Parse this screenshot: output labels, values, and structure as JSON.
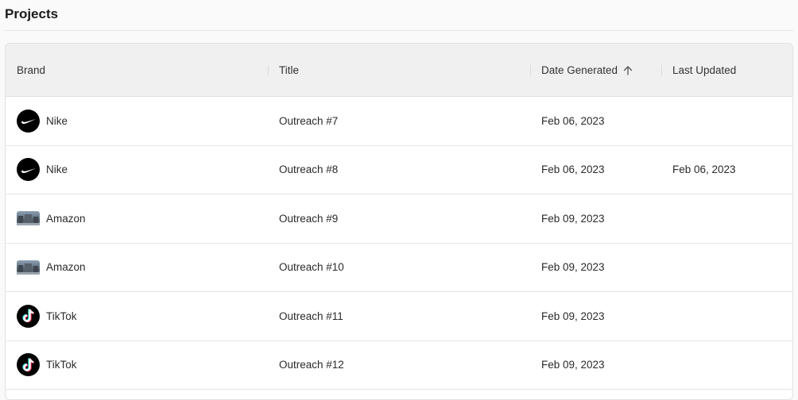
{
  "page": {
    "title": "Projects"
  },
  "table": {
    "columns": [
      {
        "label": "Brand"
      },
      {
        "label": "Title"
      },
      {
        "label": "Date Generated",
        "sort": "ascending"
      },
      {
        "label": "Last Updated"
      }
    ],
    "rows": [
      {
        "brand": "Nike",
        "brand_icon": "nike-logo-icon",
        "title": "Outreach #7",
        "date_generated": "Feb 06, 2023",
        "last_updated": ""
      },
      {
        "brand": "Nike",
        "brand_icon": "nike-logo-icon",
        "title": "Outreach #8",
        "date_generated": "Feb 06, 2023",
        "last_updated": "Feb 06, 2023"
      },
      {
        "brand": "Amazon",
        "brand_icon": "amazon-logo-icon",
        "title": "Outreach #9",
        "date_generated": "Feb 09, 2023",
        "last_updated": ""
      },
      {
        "brand": "Amazon",
        "brand_icon": "amazon-logo-icon",
        "title": "Outreach #10",
        "date_generated": "Feb 09, 2023",
        "last_updated": ""
      },
      {
        "brand": "TikTok",
        "brand_icon": "tiktok-logo-icon",
        "title": "Outreach #11",
        "date_generated": "Feb 09, 2023",
        "last_updated": ""
      },
      {
        "brand": "TikTok",
        "brand_icon": "tiktok-logo-icon",
        "title": "Outreach #12",
        "date_generated": "Feb 09, 2023",
        "last_updated": ""
      }
    ]
  },
  "colors": {
    "header_bg": "#f0f0f0",
    "row_bg": "#ffffff",
    "border": "#e2e2e2",
    "text": "#2a2a2a"
  }
}
